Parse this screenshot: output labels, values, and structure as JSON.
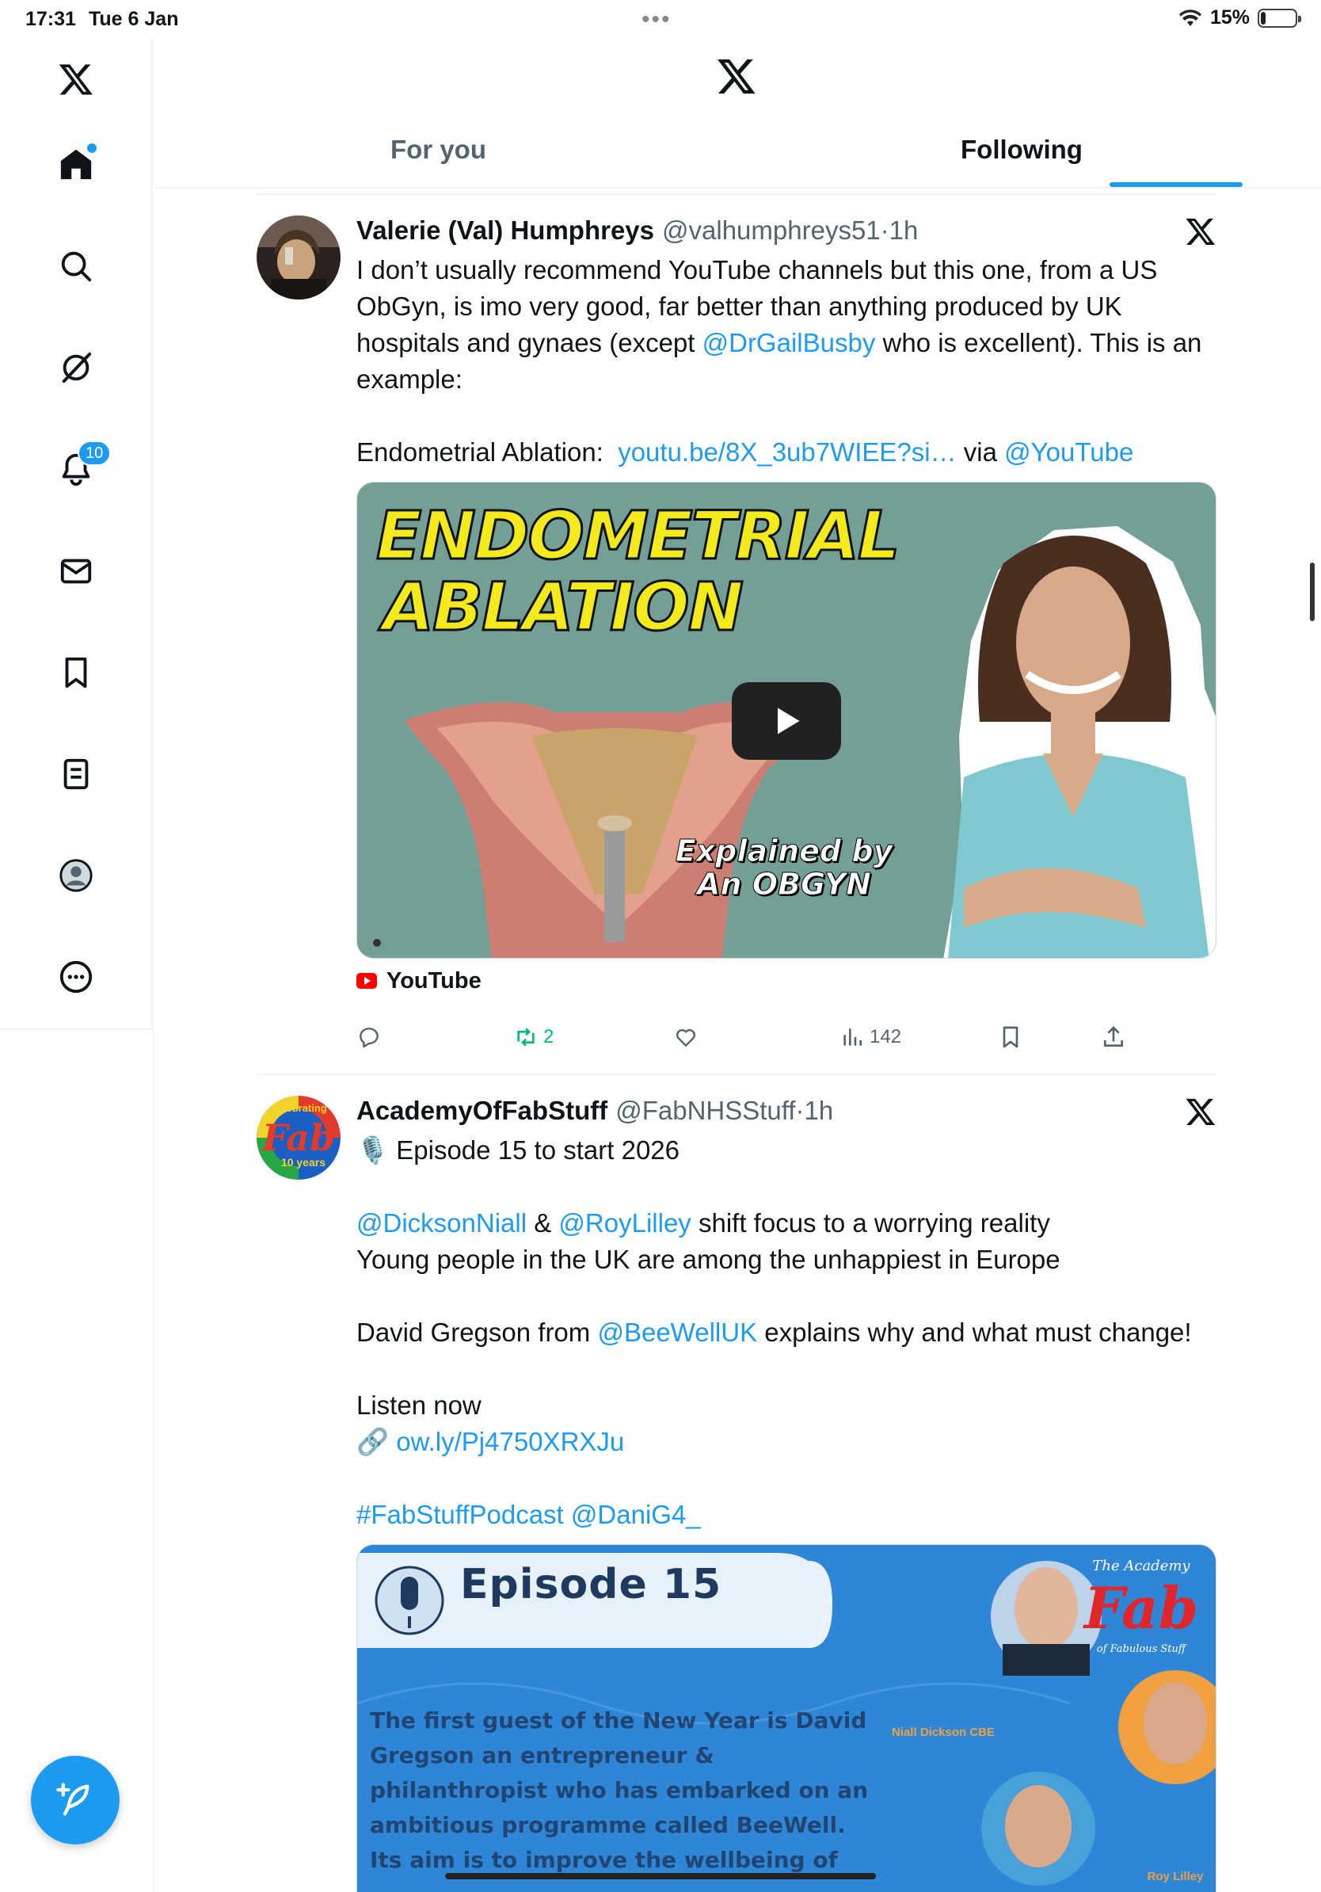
{
  "status_bar": {
    "time": "17:31",
    "date": "Tue 6 Jan",
    "battery": "15%",
    "battery_level": 0.15
  },
  "sidebar": {
    "notifications_badge": "10",
    "items": [
      "x-logo-icon",
      "home-icon",
      "search-icon",
      "grok-icon",
      "notifications-icon",
      "messages-icon",
      "bookmarks-icon",
      "lists-icon",
      "profile-icon",
      "more-icon"
    ]
  },
  "tabs": {
    "for_you": "For you",
    "following": "Following"
  },
  "tweets": [
    {
      "name": "Valerie (Val) Humphreys",
      "handle": "@valhumphreys51",
      "sep": " · ",
      "time": "1h",
      "text_1": "I don’t usually recommend YouTube channels but this one, from a US ObGyn, is imo very good, far better than anything produced by UK hospitals and gynaes (except ",
      "mention_1": "@DrGailBusby",
      "text_2": " who is excellent). This is an example:",
      "text_3": "Endometrial Ablation:  ",
      "link_1": "youtu.be/8X_3ub7WIEE?si…",
      "text_4": " via ",
      "mention_2": "@YouTube",
      "card": {
        "title_line1": "ENDOMETRIAL",
        "title_line2": "ABLATION",
        "caption_line1": "Explained by",
        "caption_line2": "An OBGYN",
        "source": "YouTube"
      },
      "stats": {
        "replies": "",
        "reposts": "2",
        "likes": "",
        "views": "142"
      }
    },
    {
      "name": "AcademyOfFabStuff",
      "handle": "@FabNHSStuff",
      "sep": " · ",
      "time": "1h",
      "avatar_top": "Celebrating",
      "avatar_main": "Fab",
      "avatar_sub": "10 years",
      "line_1": "🎙️ Episode 15 to start 2026",
      "mention_1": "@DicksonNiall",
      "amp": " & ",
      "mention_2": "@RoyLilley",
      "line_2_rest": " shift focus to a worrying reality",
      "line_3": "Young people in the UK are among the unhappiest in Europe",
      "line_4a": "David Gregson from ",
      "mention_3": "@BeeWellUK",
      "line_4b": " explains why and what must change!",
      "line_5": "Listen now",
      "link_icon": "🔗 ",
      "link_1": "ow.ly/Pj4750XRXJu",
      "hashtag": "#FabStuffPodcast",
      "mention_4": "@DaniG4_",
      "card": {
        "episode": "Episode 15",
        "body": "The first guest of the New Year is David Gregson an entrepreneur & philanthropist who has embarked on an ambitious programme called BeeWell. Its aim is to improve the wellbeing of",
        "logo_top": "The Academy",
        "logo_main": "Fab",
        "logo_sub": "of Fabulous Stuff",
        "label_1": "Niall Dickson CBE",
        "label_2": "Roy Lilley"
      }
    }
  ]
}
